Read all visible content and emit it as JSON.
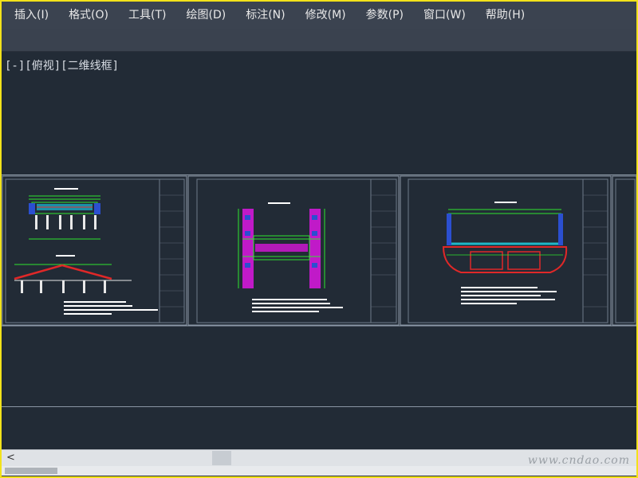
{
  "menubar": {
    "items": [
      "插入(I)",
      "格式(O)",
      "工具(T)",
      "绘图(D)",
      "标注(N)",
      "修改(M)",
      "参数(P)",
      "窗口(W)",
      "帮助(H)"
    ]
  },
  "viewport": {
    "label": "[-][俯视][二维线框]"
  },
  "scrollbar": {
    "left_arrow": "<"
  },
  "watermark": "www.cndao.com"
}
